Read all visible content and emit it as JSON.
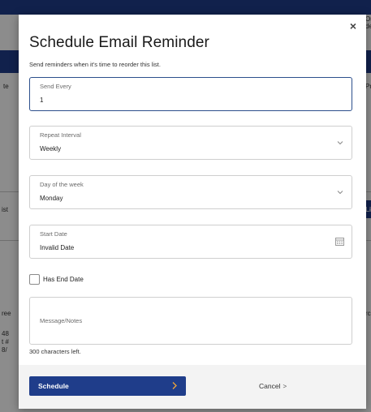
{
  "modal": {
    "title": "Schedule Email Reminder",
    "subtitle": "Send reminders when it's time to reorder this list.",
    "close_glyph": "×"
  },
  "form": {
    "send_every": {
      "label": "Send Every",
      "value": "1"
    },
    "repeat_interval": {
      "label": "Repeat Interval",
      "value": "Weekly"
    },
    "day_of_week": {
      "label": "Day of the week",
      "value": "Monday"
    },
    "start_date": {
      "label": "Start Date",
      "value": "Invalid Date"
    },
    "has_end_date": {
      "label": "Has End Date",
      "checked": false
    },
    "message": {
      "label": "Message/Notes",
      "value": ""
    },
    "chars_left": "300 characters left."
  },
  "footer": {
    "schedule_label": "Schedule",
    "cancel_label": "Cancel",
    "cancel_arrow": ">"
  },
  "background": {
    "fragments": [
      "Or",
      "de",
      "Pr",
      "Li",
      "ist",
      "rc",
      "48",
      "t #",
      "8/",
      "te",
      "ree"
    ]
  },
  "colors": {
    "primary": "#1f3d8a",
    "focus_border": "#2c4f8c",
    "field_border": "#cfcfcf",
    "footer_bg": "#f3f3f3",
    "overlay": "rgba(0,0,0,0.45)"
  },
  "icons": {
    "close": "close-icon",
    "dropdown": "chevron-down-icon",
    "calendar": "calendar-icon",
    "schedule_arrow": "chevron-right-icon"
  }
}
